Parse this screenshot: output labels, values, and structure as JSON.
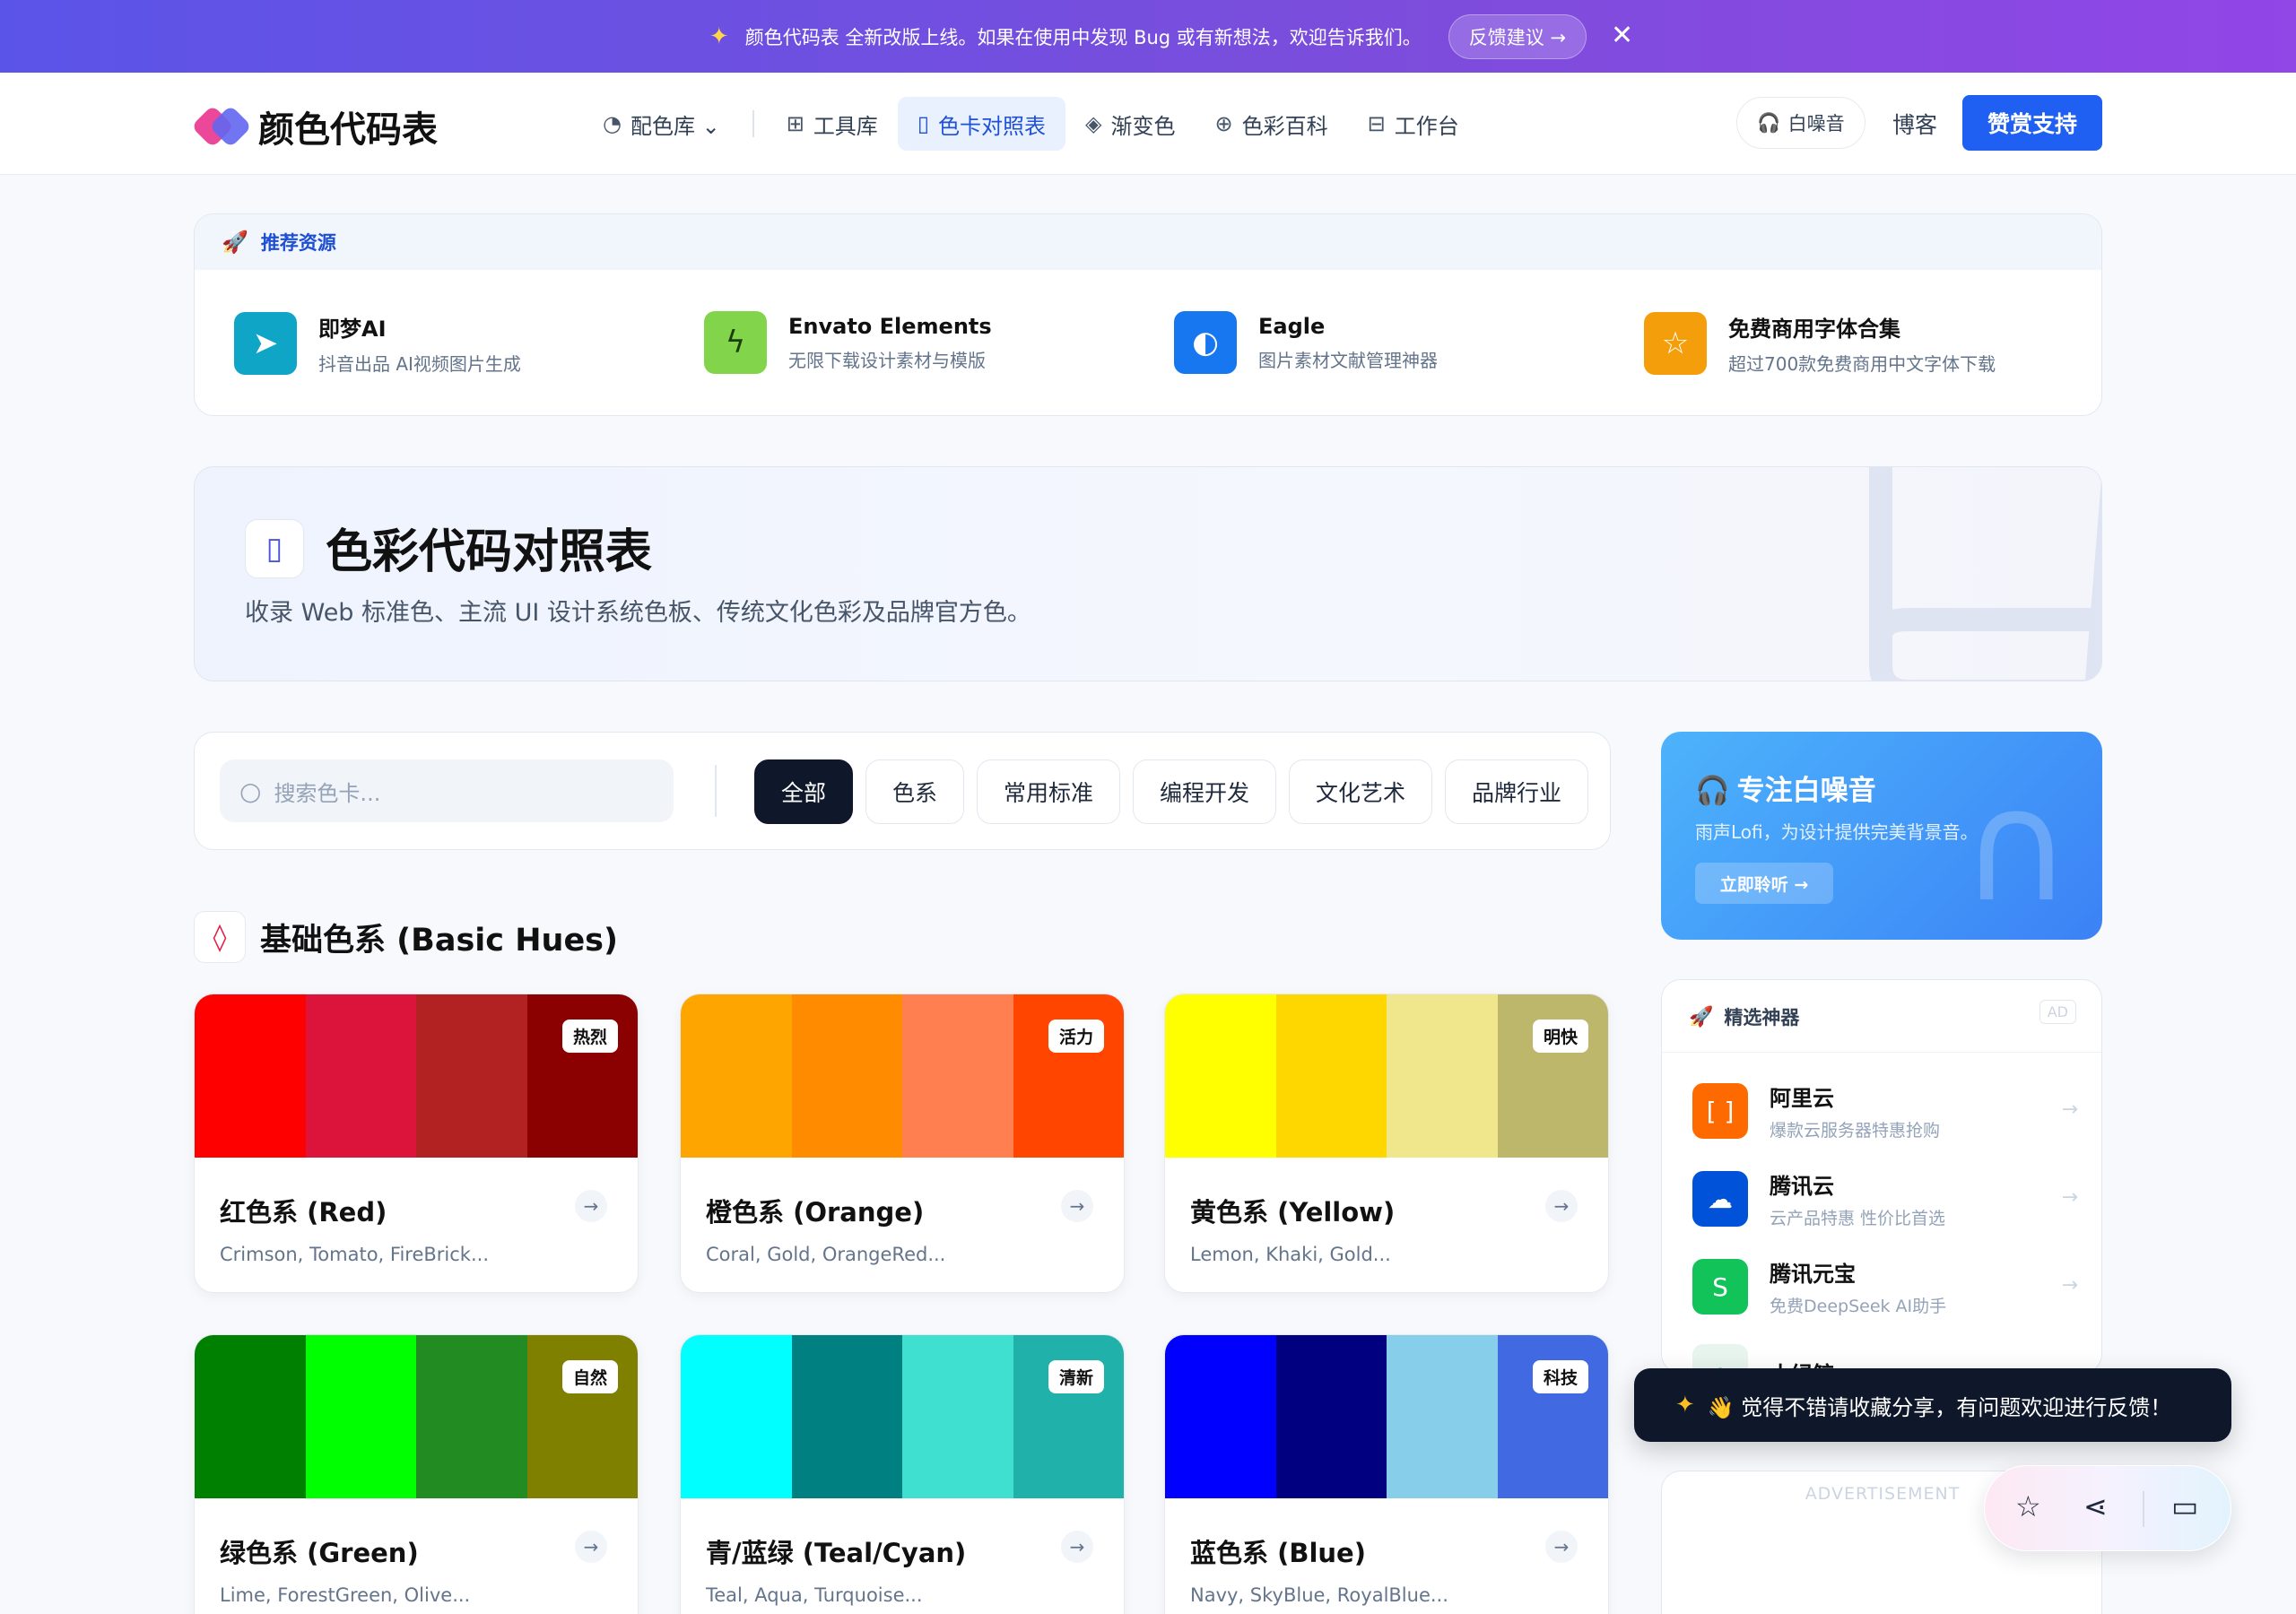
{
  "announcement": {
    "text": "颜色代码表 全新改版上线。如果在使用中发现 Bug 或有新想法，欢迎告诉我们。",
    "feedback_label": "反馈建议 →",
    "close": "✕"
  },
  "header": {
    "logo_text": "颜色代码表",
    "nav": [
      {
        "label": "配色库 ⌄",
        "icon": "palette-icon"
      },
      {
        "label": "工具库",
        "icon": "grid-icon"
      },
      {
        "label": "色卡对照表",
        "icon": "book-icon",
        "active": true
      },
      {
        "label": "渐变色",
        "icon": "layers-icon"
      },
      {
        "label": "色彩百科",
        "icon": "globe-icon"
      },
      {
        "label": "工作台",
        "icon": "briefcase-icon"
      }
    ],
    "white_noise": "白噪音",
    "blog": "博客",
    "support": "赞赏支持"
  },
  "resources": {
    "title": "推荐资源",
    "items": [
      {
        "name": "即梦AI",
        "desc": "抖音出品 AI视频图片生成",
        "color": "#0ea5c6"
      },
      {
        "name": "Envato Elements",
        "desc": "无限下载设计素材与模版",
        "color": "#82d44a"
      },
      {
        "name": "Eagle",
        "desc": "图片素材文献管理神器",
        "color": "#1677f0"
      },
      {
        "name": "免费商用字体合集",
        "desc": "超过700款免费商用中文字体下载",
        "color": "#f59e0b"
      }
    ]
  },
  "hero": {
    "title": "色彩代码对照表",
    "subtitle": "收录 Web 标准色、主流 UI 设计系统色板、传统文化色彩及品牌官方色。"
  },
  "filter": {
    "search_placeholder": "搜索色卡...",
    "chips": [
      "全部",
      "色系",
      "常用标准",
      "编程开发",
      "文化艺术",
      "品牌行业"
    ]
  },
  "section": {
    "title": "基础色系 (Basic Hues)"
  },
  "cards": [
    {
      "name": "红色系 (Red)",
      "desc": "Crimson, Tomato, FireBrick...",
      "tag": "热烈",
      "colors": [
        "#ff0000",
        "#dc143c",
        "#b22222",
        "#8b0000"
      ]
    },
    {
      "name": "橙色系 (Orange)",
      "desc": "Coral, Gold, OrangeRed...",
      "tag": "活力",
      "colors": [
        "#ffa500",
        "#ff8c00",
        "#ff7f50",
        "#ff4500"
      ]
    },
    {
      "name": "黄色系 (Yellow)",
      "desc": "Lemon, Khaki, Gold...",
      "tag": "明快",
      "colors": [
        "#ffff00",
        "#ffd700",
        "#f0e68c",
        "#bdb76b"
      ]
    },
    {
      "name": "绿色系 (Green)",
      "desc": "Lime, ForestGreen, Olive...",
      "tag": "自然",
      "colors": [
        "#008000",
        "#00ff00",
        "#228b22",
        "#808000"
      ]
    },
    {
      "name": "青/蓝绿 (Teal/Cyan)",
      "desc": "Teal, Aqua, Turquoise...",
      "tag": "清新",
      "colors": [
        "#00ffff",
        "#008080",
        "#40e0d0",
        "#20b2aa"
      ]
    },
    {
      "name": "蓝色系 (Blue)",
      "desc": "Navy, SkyBlue, RoyalBlue...",
      "tag": "科技",
      "colors": [
        "#0000ff",
        "#000080",
        "#87ceeb",
        "#4169e1"
      ]
    }
  ],
  "promo": {
    "title": "专注白噪音",
    "desc": "雨声Lofi，为设计提供完美背景音。",
    "button": "立即聆听 →"
  },
  "tools": {
    "title": "精选神器",
    "ad": "AD",
    "items": [
      {
        "name": "阿里云",
        "desc": "爆款云服务器特惠抢购",
        "color": "#ff6a00"
      },
      {
        "name": "腾讯云",
        "desc": "云产品特惠 性价比首选",
        "color": "#0052d9"
      },
      {
        "name": "腾讯元宝",
        "desc": "免费DeepSeek AI助手",
        "color": "#12c35a"
      },
      {
        "name": "小绿鲸",
        "desc": "",
        "color": "#e8f5ee"
      }
    ]
  },
  "advert": {
    "label": "ADVERTISEMENT"
  },
  "toast": {
    "text": "👋 觉得不错请收藏分享，有问题欢迎进行反馈！"
  }
}
